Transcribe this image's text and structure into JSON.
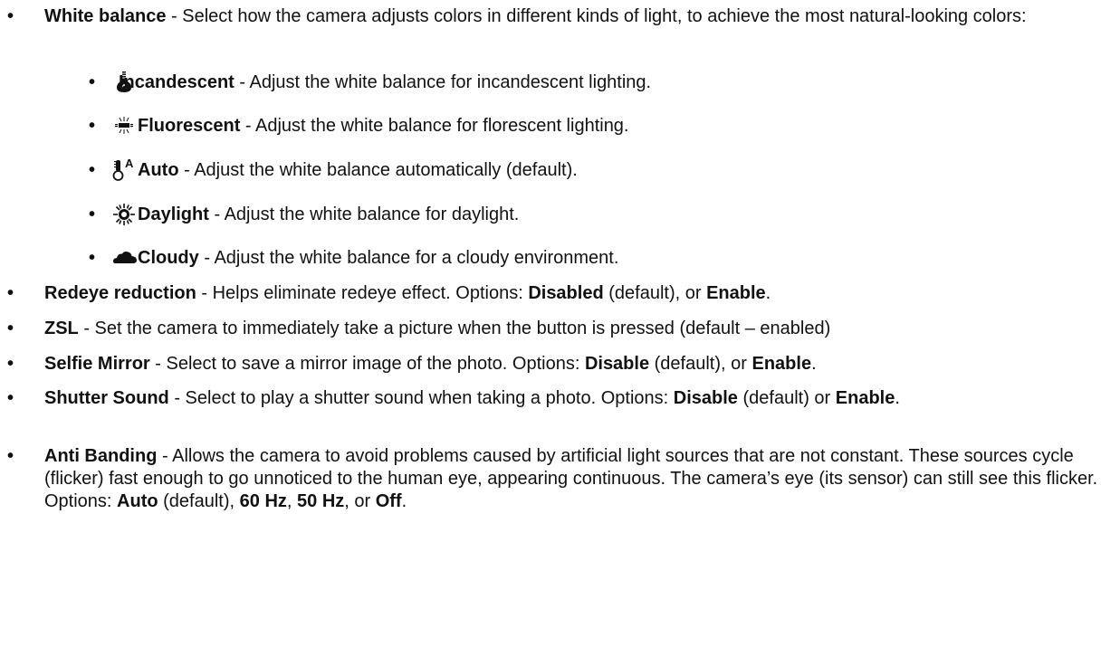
{
  "items": [
    {
      "term": "White balance",
      "desc": " - Select how the camera adjusts colors in different kinds of light, to achieve the most natural-looking colors:"
    },
    {
      "term": "Redeye reduction",
      "desc_a": " - Helps eliminate redeye effect. Options: ",
      "opt1": "Disabled",
      "desc_b": " (default), or ",
      "opt2": "Enable",
      "desc_c": "."
    },
    {
      "term": "ZSL",
      "desc": " - Set the camera to immediately take a picture when the button is pressed (default – enabled)"
    },
    {
      "term": "Selfie Mirror",
      "desc_a": " - Select to save a mirror image of the photo. Options: ",
      "opt1": "Disable",
      "desc_b": " (default), or ",
      "opt2": "Enable",
      "desc_c": "."
    },
    {
      "term": "Shutter Sound",
      "desc_a": " - Select to play a shutter sound when taking a photo. Options: ",
      "opt1": "Disable",
      "desc_b": " (default) or ",
      "opt2": "Enable",
      "desc_c": "."
    },
    {
      "term": "Anti Banding",
      "desc_a": " - Allows the camera to avoid problems caused by artificial light sources that are not constant. These sources cycle (flicker) fast enough to go unnoticed to the human eye, appearing continuous. The camera’s eye (its sensor) can still see this flicker. Options: ",
      "opt1": "Auto",
      "desc_b": " (default), ",
      "opt2": "60 Hz",
      "desc_c": ", ",
      "opt3": "50 Hz",
      "desc_d": ", or ",
      "opt4": "Off",
      "desc_e": "."
    }
  ],
  "white_balance_options": [
    {
      "icon": "incandescent-bulb-icon",
      "term": "Incandescent",
      "desc": " - Adjust the white balance for incandescent lighting."
    },
    {
      "icon": "fluorescent-tube-icon",
      "term": "Fluorescent",
      "desc": " - Adjust the white balance for florescent lighting."
    },
    {
      "icon": "auto-white-balance-icon",
      "term": "Auto",
      "desc": " - Adjust the white balance automatically (default).",
      "icon_text": "A"
    },
    {
      "icon": "daylight-sun-icon",
      "term": "Daylight",
      "desc": " - Adjust the white balance for daylight."
    },
    {
      "icon": "cloudy-cloud-icon",
      "term": "Cloudy",
      "desc": " - Adjust the white balance for a cloudy environment."
    }
  ],
  "bullet_char": "•"
}
